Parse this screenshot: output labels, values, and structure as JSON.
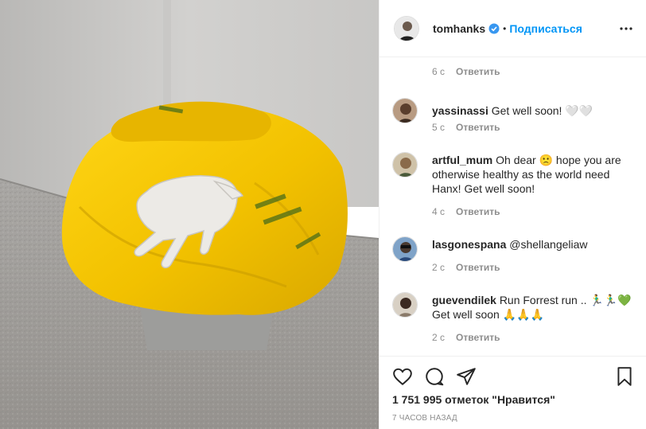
{
  "post": {
    "username": "tomhanks",
    "dot": "•",
    "follow_label": "Подписаться"
  },
  "comments": [
    {
      "time": "6 с",
      "reply_label": "Ответить"
    },
    {
      "username": "yassinassi",
      "text": "Get well soon! 🤍🤍",
      "time": "5 с",
      "reply_label": "Ответить"
    },
    {
      "username": "artful_mum",
      "text": "Oh dear 🙁 hope you are otherwise healthy as the world need Hanx! Get well soon!",
      "time": "4 с",
      "reply_label": "Ответить"
    },
    {
      "username": "lasgonespana",
      "text": "@shellangeliaw",
      "time": "2 с",
      "reply_label": "Ответить"
    },
    {
      "username": "guevendilek",
      "text": "Run Forrest run .. 🏃‍♂️🏃‍♂️💚 Get well soon 🙏🙏🙏",
      "time": "2 с",
      "reply_label": "Ответить"
    }
  ],
  "footer": {
    "likes": "1 751 995 отметок \"Нравится\"",
    "posted_ago": "7 ЧАСОВ НАЗАД"
  },
  "icons": {
    "like": "heart-icon",
    "comment": "comment-icon",
    "share": "paper-plane-icon",
    "save": "bookmark-icon",
    "more": "more-options-icon",
    "verified": "verified-badge-icon"
  },
  "colors": {
    "accent": "#0095f6",
    "verified": "#3897f0",
    "muted": "#8e8e8e",
    "bag": "#f5c400"
  }
}
